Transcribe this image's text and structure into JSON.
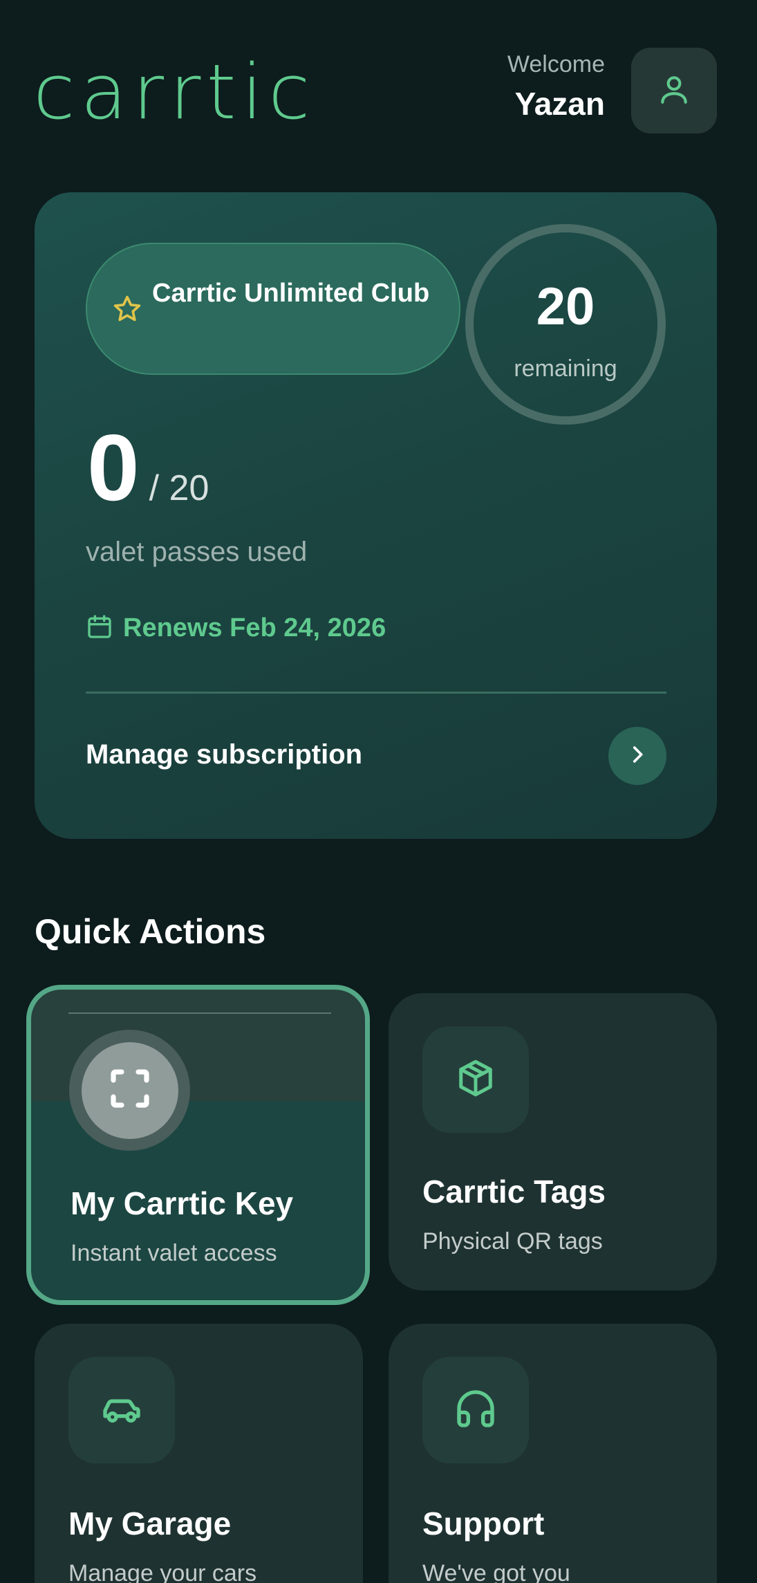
{
  "header": {
    "logo_text": "carrtic",
    "welcome_label": "Welcome",
    "user_name": "Yazan",
    "profile_icon": "user-icon"
  },
  "subscription": {
    "plan_name": "Carrtic Unlimited Club",
    "plan_icon": "star-icon",
    "remaining_count": "20",
    "remaining_label": "remaining",
    "used_count": "0",
    "total_label": "/ 20",
    "used_label": "valet passes used",
    "renew_icon": "calendar-icon",
    "renew_text": "Renews Feb 24, 2026",
    "manage_label": "Manage subscription"
  },
  "quick_actions": {
    "title": "Quick Actions",
    "items": [
      {
        "title": "My Carrtic Key",
        "subtitle": "Instant valet access",
        "icon": "scan-icon",
        "selected": true
      },
      {
        "title": "Carrtic Tags",
        "subtitle": "Physical QR tags",
        "icon": "package-icon"
      },
      {
        "title": "My Garage",
        "subtitle": "Manage your cars",
        "icon": "car-icon"
      },
      {
        "title": "Support",
        "subtitle": "We've got you",
        "icon": "headphones-icon"
      }
    ]
  },
  "colors": {
    "background": "#0d1c1d",
    "accent": "#5fca8e",
    "card": "#1f3232"
  }
}
